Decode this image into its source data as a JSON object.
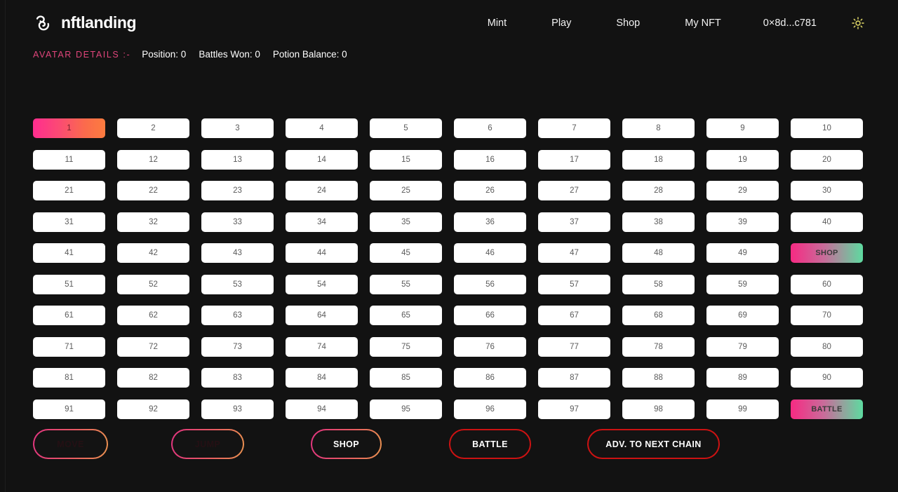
{
  "brand": {
    "name": "nftlanding",
    "logo_icon": "spiral-swirl-icon"
  },
  "nav": {
    "items": [
      {
        "label": "Mint",
        "name": "nav-item-mint"
      },
      {
        "label": "Play",
        "name": "nav-item-play"
      },
      {
        "label": "Shop",
        "name": "nav-item-shop"
      },
      {
        "label": "My NFT",
        "name": "nav-item-my-nft"
      },
      {
        "label": "0×8d...c781",
        "name": "nav-item-wallet-address"
      }
    ],
    "theme_toggle_icon": "sun-icon"
  },
  "avatar": {
    "label": "AVATAR DETAILS :-",
    "position": "Position: 0",
    "battles_won": "Battles Won: 0",
    "potion_balance": "Potion Balance: 0"
  },
  "board": {
    "columns": 10,
    "rows": 10,
    "active_cell": "1",
    "cells": [
      {
        "text": "1",
        "kind": "active"
      },
      {
        "text": "2",
        "kind": "plain"
      },
      {
        "text": "3",
        "kind": "plain"
      },
      {
        "text": "4",
        "kind": "plain"
      },
      {
        "text": "5",
        "kind": "plain"
      },
      {
        "text": "6",
        "kind": "plain"
      },
      {
        "text": "7",
        "kind": "plain"
      },
      {
        "text": "8",
        "kind": "plain"
      },
      {
        "text": "9",
        "kind": "plain"
      },
      {
        "text": "10",
        "kind": "plain"
      },
      {
        "text": "11",
        "kind": "plain"
      },
      {
        "text": "12",
        "kind": "plain"
      },
      {
        "text": "13",
        "kind": "plain"
      },
      {
        "text": "14",
        "kind": "plain"
      },
      {
        "text": "15",
        "kind": "plain"
      },
      {
        "text": "16",
        "kind": "plain"
      },
      {
        "text": "17",
        "kind": "plain"
      },
      {
        "text": "18",
        "kind": "plain"
      },
      {
        "text": "19",
        "kind": "plain"
      },
      {
        "text": "20",
        "kind": "plain"
      },
      {
        "text": "21",
        "kind": "plain"
      },
      {
        "text": "22",
        "kind": "plain"
      },
      {
        "text": "23",
        "kind": "plain"
      },
      {
        "text": "24",
        "kind": "plain"
      },
      {
        "text": "25",
        "kind": "plain"
      },
      {
        "text": "26",
        "kind": "plain"
      },
      {
        "text": "27",
        "kind": "plain"
      },
      {
        "text": "28",
        "kind": "plain"
      },
      {
        "text": "29",
        "kind": "plain"
      },
      {
        "text": "30",
        "kind": "plain"
      },
      {
        "text": "31",
        "kind": "plain"
      },
      {
        "text": "32",
        "kind": "plain"
      },
      {
        "text": "33",
        "kind": "plain"
      },
      {
        "text": "34",
        "kind": "plain"
      },
      {
        "text": "35",
        "kind": "plain"
      },
      {
        "text": "36",
        "kind": "plain"
      },
      {
        "text": "37",
        "kind": "plain"
      },
      {
        "text": "38",
        "kind": "plain"
      },
      {
        "text": "39",
        "kind": "plain"
      },
      {
        "text": "40",
        "kind": "plain"
      },
      {
        "text": "41",
        "kind": "plain"
      },
      {
        "text": "42",
        "kind": "plain"
      },
      {
        "text": "43",
        "kind": "plain"
      },
      {
        "text": "44",
        "kind": "plain"
      },
      {
        "text": "45",
        "kind": "plain"
      },
      {
        "text": "46",
        "kind": "plain"
      },
      {
        "text": "47",
        "kind": "plain"
      },
      {
        "text": "48",
        "kind": "plain"
      },
      {
        "text": "49",
        "kind": "plain"
      },
      {
        "text": "SHOP",
        "kind": "special"
      },
      {
        "text": "51",
        "kind": "plain"
      },
      {
        "text": "52",
        "kind": "plain"
      },
      {
        "text": "53",
        "kind": "plain"
      },
      {
        "text": "54",
        "kind": "plain"
      },
      {
        "text": "55",
        "kind": "plain"
      },
      {
        "text": "56",
        "kind": "plain"
      },
      {
        "text": "57",
        "kind": "plain"
      },
      {
        "text": "58",
        "kind": "plain"
      },
      {
        "text": "59",
        "kind": "plain"
      },
      {
        "text": "60",
        "kind": "plain"
      },
      {
        "text": "61",
        "kind": "plain"
      },
      {
        "text": "62",
        "kind": "plain"
      },
      {
        "text": "63",
        "kind": "plain"
      },
      {
        "text": "64",
        "kind": "plain"
      },
      {
        "text": "65",
        "kind": "plain"
      },
      {
        "text": "66",
        "kind": "plain"
      },
      {
        "text": "67",
        "kind": "plain"
      },
      {
        "text": "68",
        "kind": "plain"
      },
      {
        "text": "69",
        "kind": "plain"
      },
      {
        "text": "70",
        "kind": "plain"
      },
      {
        "text": "71",
        "kind": "plain"
      },
      {
        "text": "72",
        "kind": "plain"
      },
      {
        "text": "73",
        "kind": "plain"
      },
      {
        "text": "74",
        "kind": "plain"
      },
      {
        "text": "75",
        "kind": "plain"
      },
      {
        "text": "76",
        "kind": "plain"
      },
      {
        "text": "77",
        "kind": "plain"
      },
      {
        "text": "78",
        "kind": "plain"
      },
      {
        "text": "79",
        "kind": "plain"
      },
      {
        "text": "80",
        "kind": "plain"
      },
      {
        "text": "81",
        "kind": "plain"
      },
      {
        "text": "82",
        "kind": "plain"
      },
      {
        "text": "83",
        "kind": "plain"
      },
      {
        "text": "84",
        "kind": "plain"
      },
      {
        "text": "85",
        "kind": "plain"
      },
      {
        "text": "86",
        "kind": "plain"
      },
      {
        "text": "87",
        "kind": "plain"
      },
      {
        "text": "88",
        "kind": "plain"
      },
      {
        "text": "89",
        "kind": "plain"
      },
      {
        "text": "90",
        "kind": "plain"
      },
      {
        "text": "91",
        "kind": "plain"
      },
      {
        "text": "92",
        "kind": "plain"
      },
      {
        "text": "93",
        "kind": "plain"
      },
      {
        "text": "94",
        "kind": "plain"
      },
      {
        "text": "95",
        "kind": "plain"
      },
      {
        "text": "96",
        "kind": "plain"
      },
      {
        "text": "97",
        "kind": "plain"
      },
      {
        "text": "98",
        "kind": "plain"
      },
      {
        "text": "99",
        "kind": "plain"
      },
      {
        "text": "BATTLE",
        "kind": "special"
      }
    ]
  },
  "actions": {
    "move": "MOVE",
    "jump": "JUMP",
    "shop": "SHOP",
    "battle": "BATTLE",
    "advance": "ADV. TO NEXT CHAIN"
  },
  "colors": {
    "background": "#121212",
    "accent_pink": "#e0457b",
    "gradient_start": "#ff2d8f",
    "gradient_end": "#fc7c3f",
    "special_green": "#5ddba0",
    "danger_red": "#cc1212",
    "cell_white": "#ffffff",
    "cell_text": "#5b5b5b",
    "sun_yellow": "#e8e06a"
  }
}
